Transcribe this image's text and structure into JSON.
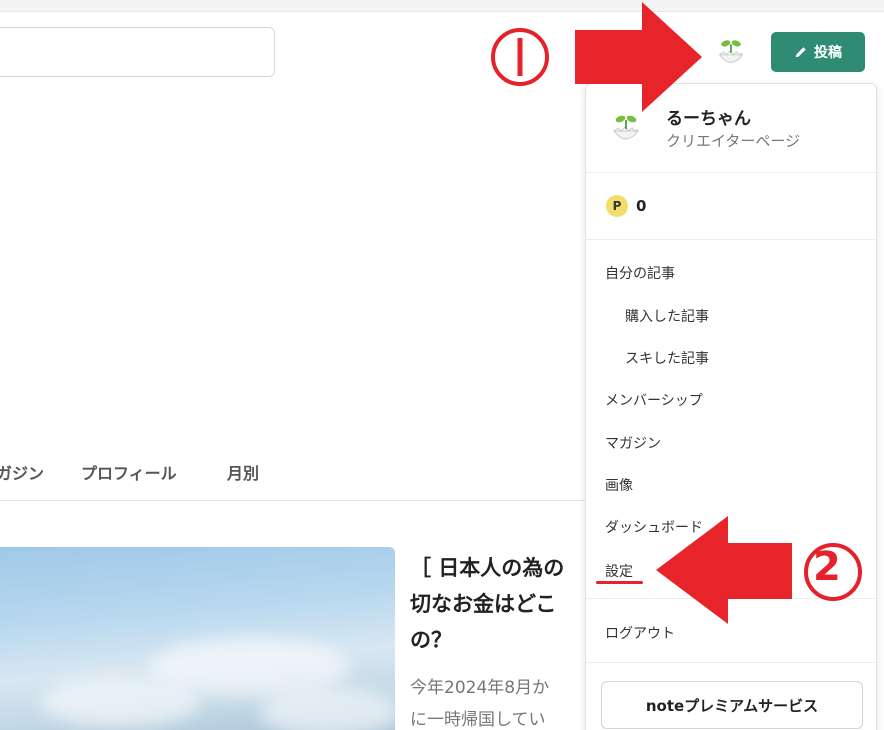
{
  "header": {
    "search_placeholder": "",
    "post_button_label": "投稿"
  },
  "tabs": [
    "ガジン",
    "プロフィール",
    "月別"
  ],
  "article": {
    "title": "［ 日本人の為の\n切なお金はどこ\nの？",
    "description": "今年2024年8月か\nに一時帰国してい"
  },
  "dropdown": {
    "user_name": "るーちゃん",
    "creator_page_label": "クリエイターページ",
    "points_badge": "P",
    "points_value": "0",
    "items": [
      {
        "label": "自分の記事"
      },
      {
        "label": "購入した記事"
      },
      {
        "label": "スキした記事"
      },
      {
        "label": "メンバーシップ"
      },
      {
        "label": "マガジン"
      },
      {
        "label": "画像"
      },
      {
        "label": "ダッシュボード"
      },
      {
        "label": "設定"
      },
      {
        "label": "ログアウト"
      }
    ],
    "premium_label": "noteプレミアムサービス"
  },
  "annotations": {
    "step1": "①",
    "step2": "②",
    "arrow_color": "#e8242b"
  },
  "icons": [
    "pencil-icon",
    "sprout-avatar-icon"
  ]
}
